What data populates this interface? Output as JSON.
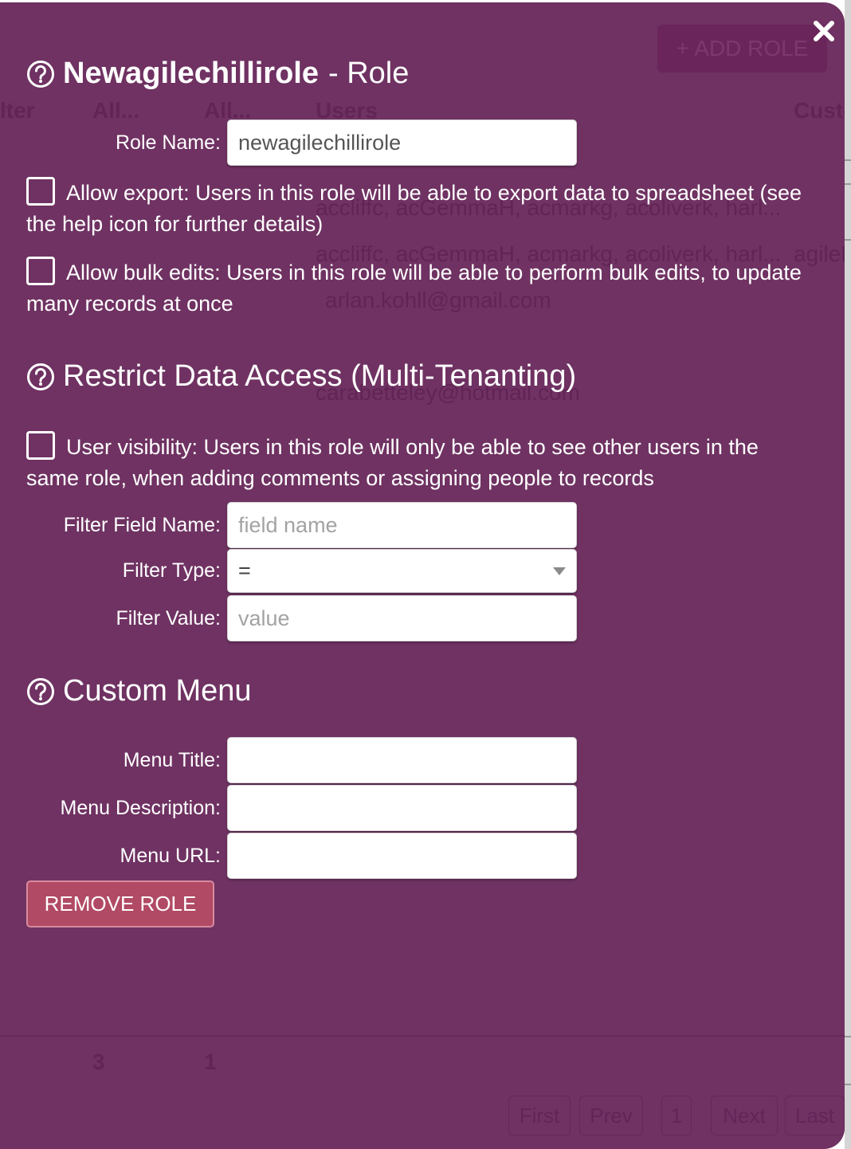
{
  "modal": {
    "title_name": "Newagilechillirole",
    "title_suffix": "- Role",
    "close_icon": "close-icon",
    "role_name": {
      "label": "Role Name:",
      "value": "newagilechillirole"
    },
    "allow_export": {
      "checked": false,
      "text": "Allow export: Users in this role will be able to export data to spreadsheet (see the help icon for further details)"
    },
    "allow_bulk_edits": {
      "checked": false,
      "text": "Allow bulk edits: Users in this role will be able to perform bulk edits, to update many records at once"
    },
    "restrict_section": {
      "title": "Restrict Data Access (Multi-Tenanting)",
      "user_visibility": {
        "checked": false,
        "text": "User visibility: Users in this role will only be able to see other users in the same role, when adding comments or assigning people to records"
      },
      "filter_field_name": {
        "label": "Filter Field Name:",
        "value": "",
        "placeholder": "field name"
      },
      "filter_type": {
        "label": "Filter Type:",
        "selected": "="
      },
      "filter_value": {
        "label": "Filter Value:",
        "value": "",
        "placeholder": "value"
      }
    },
    "custom_menu_section": {
      "title": "Custom Menu",
      "menu_title": {
        "label": "Menu Title:",
        "value": ""
      },
      "menu_description": {
        "label": "Menu Description:",
        "value": ""
      },
      "menu_url": {
        "label": "Menu URL:",
        "value": ""
      }
    },
    "remove_button": "REMOVE ROLE"
  },
  "background": {
    "add_role_button": "+ ADD ROLE",
    "column_headers": [
      "lter",
      "All...",
      "All...",
      "Users",
      "Custo"
    ],
    "rows": [
      "accliffc, acGemmaH, acmarkg, acoliverk, harl...",
      "accliffc, acGemmaH, acmarkg, acoliverk, harl...",
      "arlan.kohll@gmail.com",
      "carabetteley@hotmail.com"
    ],
    "row_extra": "agileB",
    "footer_counts": [
      "3",
      "1"
    ],
    "pagination": [
      "First",
      "Prev",
      "1",
      "Next",
      "Last"
    ]
  }
}
